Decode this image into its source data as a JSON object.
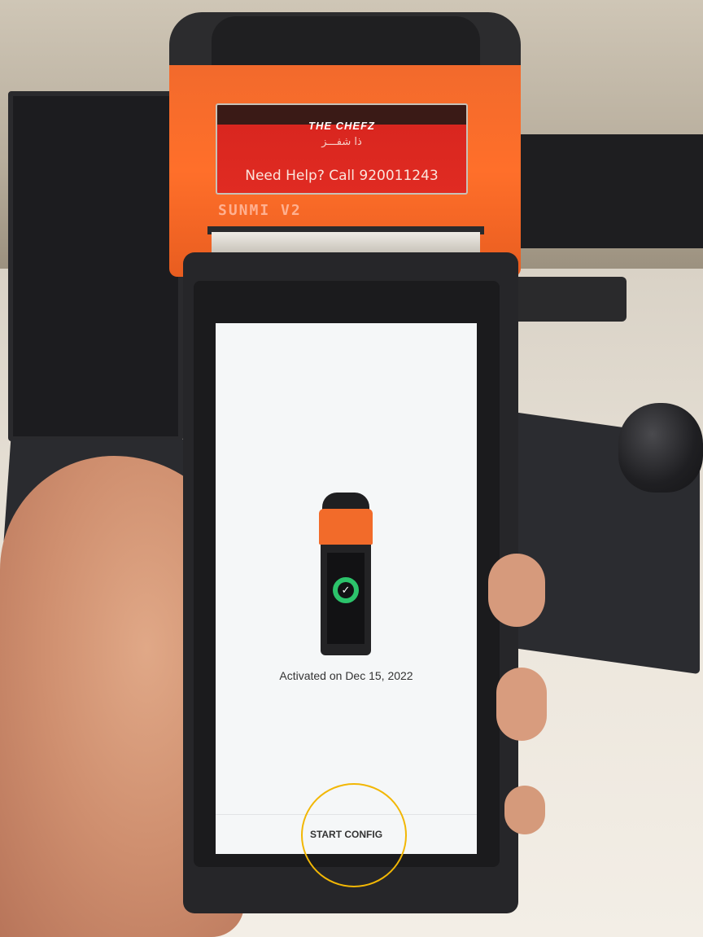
{
  "printer_label": {
    "brand": "THE CHEFZ",
    "arabic_brand": "ذا شفـــز",
    "help_text": "Need Help? Call 920011243"
  },
  "device_model": "SUNMI V2",
  "screen": {
    "activation_text": "Activated on Dec 15, 2022",
    "start_button_label": "START CONFIG"
  },
  "colors": {
    "device_orange": "#f26a2c",
    "check_green": "#2cc36b",
    "highlight_circle": "#f2b705"
  },
  "icons": {
    "check": "check-circle-icon"
  }
}
